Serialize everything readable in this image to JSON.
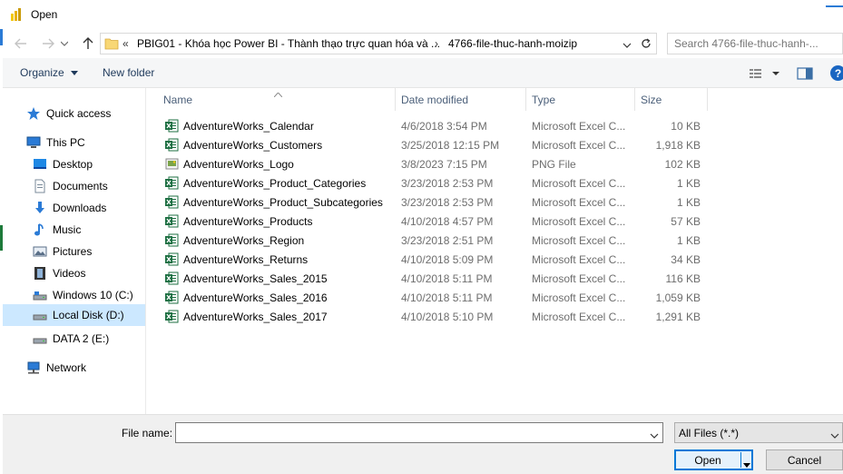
{
  "window": {
    "title": "Open"
  },
  "nav": {
    "back_icon": "arrow-left-icon",
    "forward_icon": "arrow-right-icon",
    "recent_icon": "chevron-down-icon",
    "up_icon": "arrow-up-icon"
  },
  "address": {
    "overflow": "«",
    "segment_1": "PBIG01 - Khóa học Power BI - Thành thạo trực quan hóa và ...",
    "segment_2": "4766-file-thuc-hanh-moizip"
  },
  "search": {
    "placeholder": "Search 4766-file-thuc-hanh-..."
  },
  "toolbar": {
    "organize_label": "Organize",
    "new_folder_label": "New folder"
  },
  "sidebar": {
    "items": [
      {
        "label": "Quick access",
        "icon": "star-icon"
      },
      {
        "label": "This PC",
        "icon": "computer-icon"
      },
      {
        "label": "Desktop",
        "icon": "desktop-icon"
      },
      {
        "label": "Documents",
        "icon": "documents-icon"
      },
      {
        "label": "Downloads",
        "icon": "downloads-icon"
      },
      {
        "label": "Music",
        "icon": "music-icon"
      },
      {
        "label": "Pictures",
        "icon": "pictures-icon"
      },
      {
        "label": "Videos",
        "icon": "videos-icon"
      },
      {
        "label": "Windows 10 (C:)",
        "icon": "drive-icon"
      },
      {
        "label": "Local Disk (D:)",
        "icon": "drive-icon",
        "selected": true
      },
      {
        "label": "DATA 2 (E:)",
        "icon": "drive-icon"
      },
      {
        "label": "Network",
        "icon": "network-icon"
      }
    ]
  },
  "columns": {
    "name": "Name",
    "date": "Date modified",
    "type": "Type",
    "size": "Size"
  },
  "files": [
    {
      "name": "AdventureWorks_Calendar",
      "date": "4/6/2018 3:54 PM",
      "type": "Microsoft Excel C...",
      "size": "10 KB",
      "icon": "excel-icon"
    },
    {
      "name": "AdventureWorks_Customers",
      "date": "3/25/2018 12:15 PM",
      "type": "Microsoft Excel C...",
      "size": "1,918 KB",
      "icon": "excel-icon"
    },
    {
      "name": "AdventureWorks_Logo",
      "date": "3/8/2023 7:15 PM",
      "type": "PNG File",
      "size": "102 KB",
      "icon": "image-file-icon"
    },
    {
      "name": "AdventureWorks_Product_Categories",
      "date": "3/23/2018 2:53 PM",
      "type": "Microsoft Excel C...",
      "size": "1 KB",
      "icon": "excel-icon"
    },
    {
      "name": "AdventureWorks_Product_Subcategories",
      "date": "3/23/2018 2:53 PM",
      "type": "Microsoft Excel C...",
      "size": "1 KB",
      "icon": "excel-icon"
    },
    {
      "name": "AdventureWorks_Products",
      "date": "4/10/2018 4:57 PM",
      "type": "Microsoft Excel C...",
      "size": "57 KB",
      "icon": "excel-icon"
    },
    {
      "name": "AdventureWorks_Region",
      "date": "3/23/2018 2:51 PM",
      "type": "Microsoft Excel C...",
      "size": "1 KB",
      "icon": "excel-icon"
    },
    {
      "name": "AdventureWorks_Returns",
      "date": "4/10/2018 5:09 PM",
      "type": "Microsoft Excel C...",
      "size": "34 KB",
      "icon": "excel-icon"
    },
    {
      "name": "AdventureWorks_Sales_2015",
      "date": "4/10/2018 5:11 PM",
      "type": "Microsoft Excel C...",
      "size": "116 KB",
      "icon": "excel-icon"
    },
    {
      "name": "AdventureWorks_Sales_2016",
      "date": "4/10/2018 5:11 PM",
      "type": "Microsoft Excel C...",
      "size": "1,059 KB",
      "icon": "excel-icon"
    },
    {
      "name": "AdventureWorks_Sales_2017",
      "date": "4/10/2018 5:10 PM",
      "type": "Microsoft Excel C...",
      "size": "1,291 KB",
      "icon": "excel-icon"
    }
  ],
  "footer": {
    "file_name_label": "File name:",
    "file_name_value": "",
    "filter_value": "All Files (*.*)",
    "open_label": "Open",
    "cancel_label": "Cancel"
  },
  "colors": {
    "accent": "#0078d7",
    "selection": "#cce8ff",
    "excel_green": "#1d6f42",
    "folder_yellow": "#f8d775"
  }
}
